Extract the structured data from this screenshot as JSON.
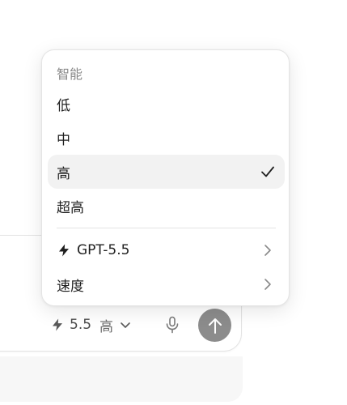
{
  "menu": {
    "header": "智能",
    "items": [
      {
        "label": "低"
      },
      {
        "label": "中"
      },
      {
        "label": "高",
        "selected": true
      },
      {
        "label": "超高"
      }
    ],
    "model_item": {
      "label": "GPT-5.5",
      "icon": "bolt-icon"
    },
    "speed_item": {
      "label": "速度"
    }
  },
  "composer": {
    "model_version": "5.5",
    "model_level": "高"
  },
  "colors": {
    "selected_bg": "#f2f2f2",
    "send_button": "#8c8c8c"
  }
}
